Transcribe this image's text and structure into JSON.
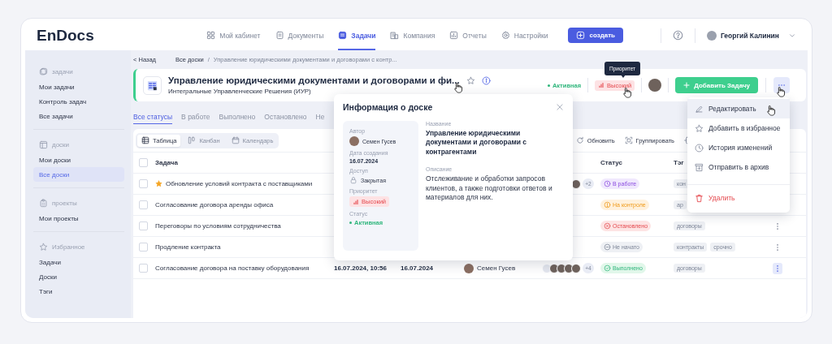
{
  "header": {
    "logo": "EnDocs",
    "nav": [
      {
        "label": "Мой кабинет",
        "selected": false
      },
      {
        "label": "Документы",
        "selected": false
      },
      {
        "label": "Задачи",
        "selected": true
      },
      {
        "label": "Компания",
        "selected": false
      },
      {
        "label": "Отчеты",
        "selected": false
      },
      {
        "label": "Настройки",
        "selected": false
      }
    ],
    "create_button": "создать",
    "user": {
      "name": "Георгий Калинин"
    }
  },
  "sidebar": {
    "sections": [
      {
        "title": "задачи",
        "items": [
          {
            "label": "Мои задачи",
            "selected": false
          },
          {
            "label": "Контроль задач",
            "selected": false
          },
          {
            "label": "Все задачи",
            "selected": false
          }
        ]
      },
      {
        "title": "доски",
        "items": [
          {
            "label": "Мои доски",
            "selected": false
          },
          {
            "label": "Все доски",
            "selected": true
          }
        ]
      },
      {
        "title": "проекты",
        "items": [
          {
            "label": "Мои проекты",
            "selected": false
          }
        ]
      },
      {
        "title": "Избранное",
        "items": [
          {
            "label": "Задачи",
            "selected": false
          },
          {
            "label": "Доски",
            "selected": false
          },
          {
            "label": "Тэги",
            "selected": false
          }
        ]
      }
    ]
  },
  "breadcrumb": {
    "back": "< Назад",
    "path": [
      "Все доски",
      "/",
      "Управление юридическими документами и договорами с контр..."
    ]
  },
  "board": {
    "title": "Управление юридическими документами и договорами и фи...",
    "subtitle": "Интегральные Управленческие Решения (ИУР)",
    "status": "Активная",
    "priority": "Высокий",
    "add_button": "Добавить Задачу"
  },
  "tooltip": "Приоритет",
  "status_tabs": [
    {
      "label": "Все статусы",
      "selected": true
    },
    {
      "label": "В работе",
      "selected": false
    },
    {
      "label": "Выполнено",
      "selected": false
    },
    {
      "label": "Остановлено",
      "selected": false
    },
    {
      "label": "Не",
      "selected": false
    }
  ],
  "views": [
    {
      "label": "Таблица",
      "selected": true
    },
    {
      "label": "Канбан",
      "selected": false
    },
    {
      "label": "Календарь",
      "selected": false
    }
  ],
  "actions": [
    "Обновить",
    "Группировать"
  ],
  "table": {
    "select_all": {
      "checked": false
    },
    "columns": [
      "Задача",
      "Статус",
      "Тэг"
    ],
    "rows": [
      {
        "checked": false,
        "task": "Обновление условий контракта с поставщиками",
        "starred": true,
        "participants": {
          "avatars": [
            {
              "kind": "photo"
            }
          ],
          "more": "+2"
        },
        "status": {
          "kind": "in_progress",
          "label": "В работе"
        },
        "tags": [
          "кон"
        ]
      },
      {
        "checked": false,
        "task": "Согласование договора аренды офиса",
        "starred": false,
        "status": {
          "kind": "review",
          "label": "На контроле"
        },
        "tags": [
          "ар"
        ]
      },
      {
        "checked": false,
        "task": "Переговоры по условиям сотрудничества",
        "starred": false,
        "status": {
          "kind": "stopped",
          "label": "Остановлено"
        },
        "tags": [
          "договоры"
        ],
        "menu": {
          "selected": false
        }
      },
      {
        "checked": false,
        "task": "Продление контракта",
        "starred": false,
        "status": {
          "kind": "not_started",
          "label": "Не начато"
        },
        "tags": [
          "контракты",
          "срочно"
        ],
        "menu": {
          "selected": false
        }
      },
      {
        "checked": false,
        "task": "Согласование договора на поставку оборудования",
        "starred": false,
        "created": "16.07.2024, 10:56",
        "due": "16.07.2024",
        "author": "Семен Гусев",
        "participants": {
          "avatars": [
            {
              "kind": "blank"
            },
            {
              "kind": "photo"
            },
            {
              "kind": "photo"
            },
            {
              "kind": "photo"
            },
            {
              "kind": "photo"
            }
          ],
          "more": "+4"
        },
        "status": {
          "kind": "done",
          "label": "Выполнено"
        },
        "tags": [
          "договоры"
        ],
        "menu": {
          "selected": true
        }
      }
    ]
  },
  "info_popup": {
    "title": "Информация о доске",
    "fields": [
      {
        "label": "Автор",
        "kind": "person",
        "value": "Семен Гусев"
      },
      {
        "label": "Дата создания",
        "kind": "text",
        "value": "16.07.2024"
      },
      {
        "label": "Доступ",
        "kind": "lock",
        "value": "Закрытая"
      },
      {
        "label": "Приоритет",
        "kind": "priority",
        "value": "Высокий"
      },
      {
        "label": "Статус",
        "kind": "status",
        "value": "Активная"
      }
    ],
    "details": [
      {
        "label": "Название",
        "kind": "bold",
        "value": "Управление юридическими документами и договорами с контрагентами"
      },
      {
        "label": "Описание",
        "kind": "text",
        "value": "Отслеживание и обработки запросов клиентов, а также подготовки ответов и материалов для них."
      }
    ]
  },
  "menu": {
    "items": [
      {
        "label": "Редактировать",
        "kind": "normal",
        "hovered": true
      },
      {
        "label": "Добавить в избранное",
        "kind": "normal",
        "hovered": false
      },
      {
        "label": "История изменений",
        "kind": "normal",
        "hovered": false
      },
      {
        "label": "Отправить в архив",
        "kind": "normal",
        "hovered": false
      },
      {
        "label": "Удалить",
        "kind": "danger",
        "hovered": false
      }
    ]
  }
}
